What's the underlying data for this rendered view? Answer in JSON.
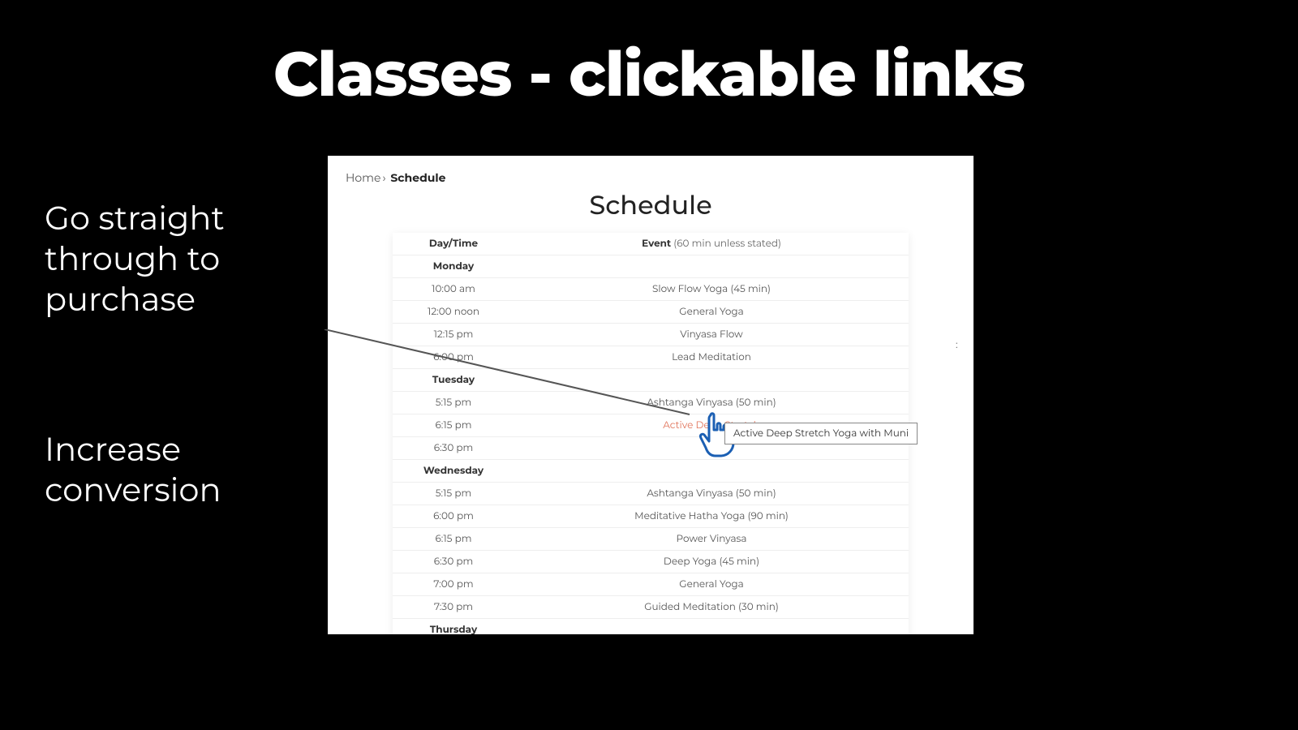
{
  "headline": "Classes - clickable links",
  "side1_l1": "Go straight",
  "side1_l2": "through to",
  "side1_l3": "purchase",
  "side2_l1": "Increase",
  "side2_l2": "conversion",
  "breadcrumb": {
    "home": "Home",
    "sep": "›",
    "current": "Schedule"
  },
  "page_title": "Schedule",
  "table_header": {
    "time": "Day/Time",
    "event_label": "Event",
    "event_note": " (60 min unless stated)"
  },
  "tooltip": "Active Deep Stretch Yoga with Muni",
  "link_color": "#e1745b",
  "stray": ":",
  "schedule": [
    {
      "type": "day",
      "label": "Monday"
    },
    {
      "type": "class",
      "time": "10:00 am",
      "event": "Slow Flow Yoga (45 min)"
    },
    {
      "type": "class",
      "time": "12:00 noon",
      "event": "General Yoga"
    },
    {
      "type": "class",
      "time": "12:15 pm",
      "event": "Vinyasa Flow"
    },
    {
      "type": "class",
      "time": "6:00 pm",
      "event": "Lead Meditation"
    },
    {
      "type": "day",
      "label": "Tuesday"
    },
    {
      "type": "class",
      "time": "5:15 pm",
      "event": "Ashtanga Vinyasa (50 min)"
    },
    {
      "type": "link",
      "time": "6:15 pm",
      "event": "Active Deep Stretch"
    },
    {
      "type": "class",
      "time": "6:30 pm",
      "event": ""
    },
    {
      "type": "day",
      "label": "Wednesday"
    },
    {
      "type": "class",
      "time": "5:15 pm",
      "event": "Ashtanga Vinyasa (50 min)"
    },
    {
      "type": "class",
      "time": "6:00 pm",
      "event": "Meditative Hatha Yoga (90 min)"
    },
    {
      "type": "class",
      "time": "6:15 pm",
      "event": "Power Vinyasa"
    },
    {
      "type": "class",
      "time": "6:30 pm",
      "event": "Deep Yoga (45 min)"
    },
    {
      "type": "class",
      "time": "7:00 pm",
      "event": "General Yoga"
    },
    {
      "type": "class",
      "time": "7:30 pm",
      "event": "Guided Meditation (30 min)"
    },
    {
      "type": "day",
      "label": "Thursday"
    }
  ]
}
